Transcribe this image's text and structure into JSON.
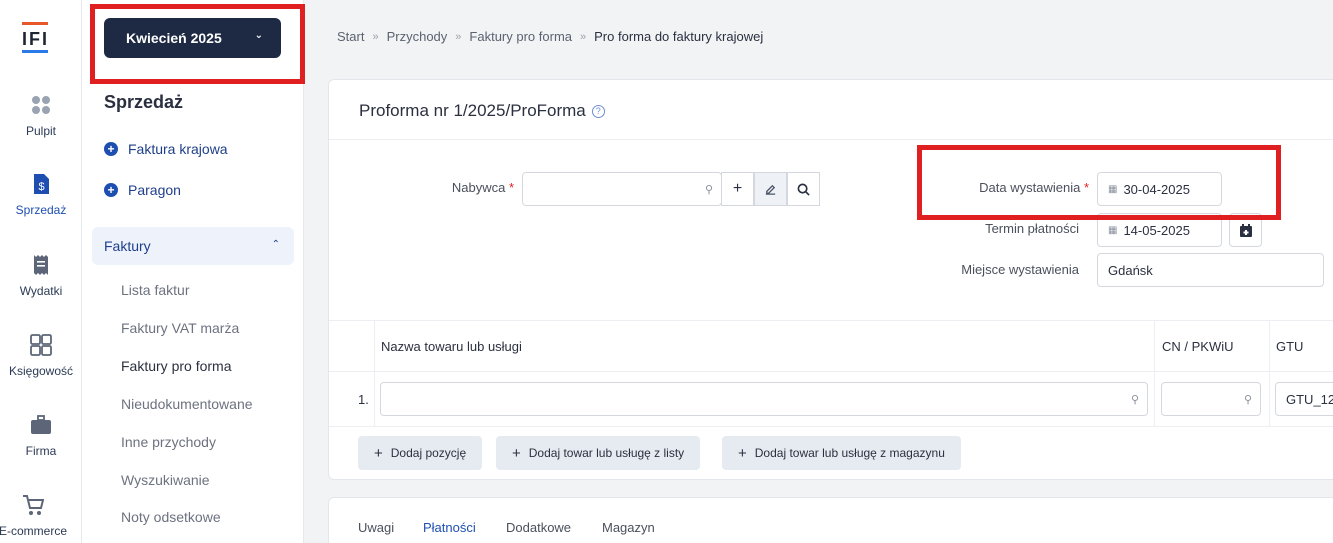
{
  "app": {
    "logo_text": "IFI"
  },
  "rail": [
    {
      "label": "Pulpit",
      "icon": "dashboard-icon"
    },
    {
      "label": "Sprzedaż",
      "icon": "invoice-dollar-icon"
    },
    {
      "label": "Wydatki",
      "icon": "receipt-icon"
    },
    {
      "label": "Księgowość",
      "icon": "calculator-icon"
    },
    {
      "label": "Firma",
      "icon": "briefcase-icon"
    },
    {
      "label": "E-commerce",
      "icon": "cart-icon"
    }
  ],
  "sidebar": {
    "period": "Kwiecień 2025",
    "section_title": "Sprzedaż",
    "quick_add": [
      "Faktura krajowa",
      "Paragon"
    ],
    "group_label": "Faktury",
    "items": [
      "Lista faktur",
      "Faktury VAT marża",
      "Faktury pro forma",
      "Nieudokumentowane",
      "Inne przychody",
      "Wyszukiwanie",
      "Noty odsetkowe"
    ]
  },
  "breadcrumb": [
    "Start",
    "Przychody",
    "Faktury pro forma",
    "Pro forma do faktury krajowej"
  ],
  "form": {
    "title": "Proforma nr 1/2025/ProForma",
    "buyer_label": "Nabywca",
    "buyer_value": "",
    "issue_date_label": "Data wystawienia",
    "issue_date": "30-04-2025",
    "due_date_label": "Termin płatności",
    "due_date": "14-05-2025",
    "place_label": "Miejsce wystawienia",
    "place_value": "Gdańsk"
  },
  "items_table": {
    "headers": [
      "Nazwa towaru lub usługi",
      "CN / PKWiU",
      "GTU"
    ],
    "rows": [
      {
        "index": "1.",
        "name": "",
        "cn": "",
        "gtu": "GTU_12"
      }
    ]
  },
  "actions": [
    "Dodaj pozycję",
    "Dodaj towar lub usługę z listy",
    "Dodaj towar lub usługę z magazynu"
  ],
  "tabs": [
    "Uwagi",
    "Płatności",
    "Dodatkowe",
    "Magazyn"
  ],
  "colors": {
    "highlight": "#e02020",
    "navy": "#1e2a44",
    "accent": "#1e4fb0"
  }
}
